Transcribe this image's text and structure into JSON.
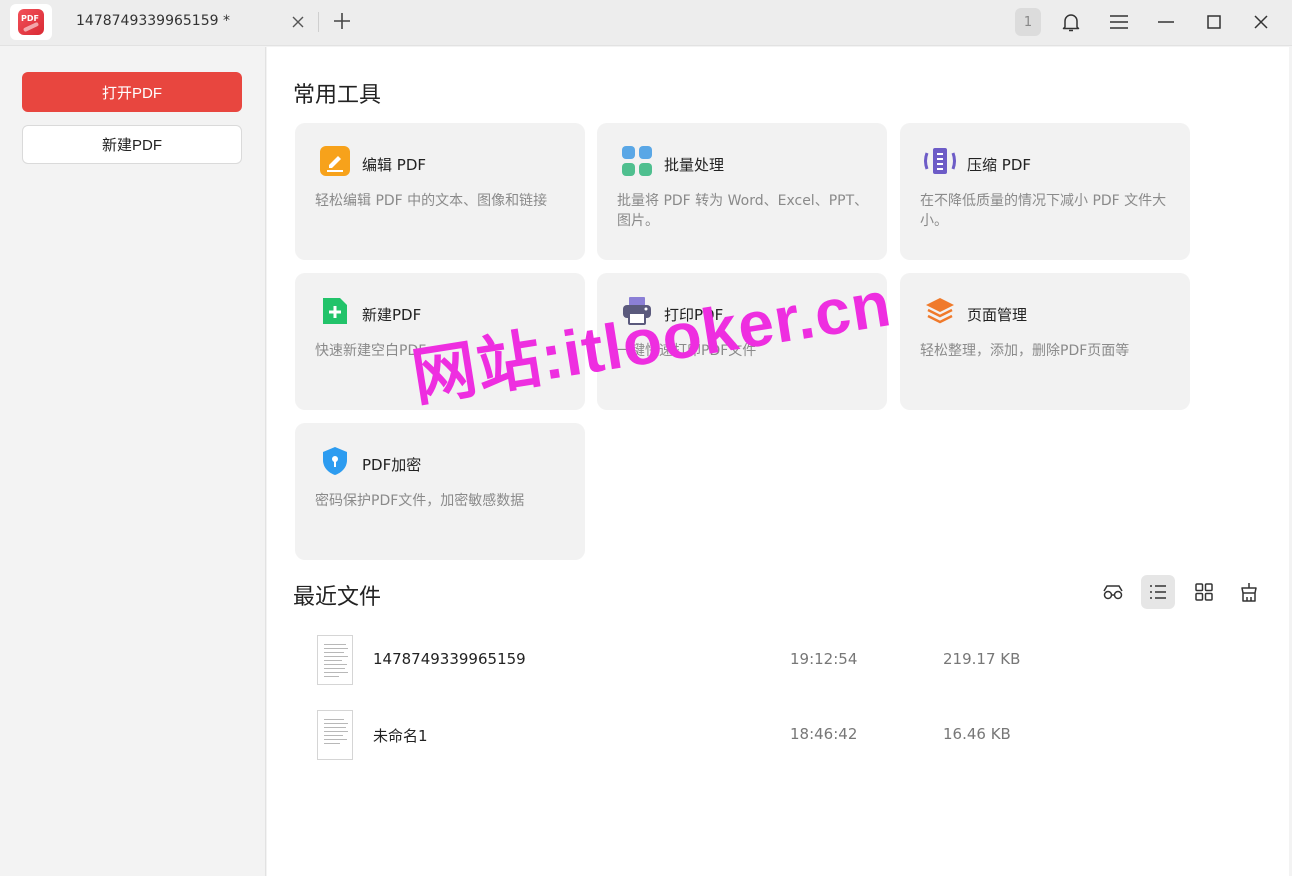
{
  "titlebar": {
    "tab_title": "1478749339965159 *",
    "notification_count": "1",
    "icons": [
      "close-icon",
      "plus-icon",
      "bell-icon",
      "menu-icon",
      "minimize-icon",
      "maximize-icon",
      "close-window-icon"
    ]
  },
  "logo": {
    "text": "PDF"
  },
  "sidebar": {
    "open_label": "打开PDF",
    "new_label": "新建PDF",
    "accent": "#e8463f"
  },
  "tools": {
    "title": "常用工具",
    "items": [
      {
        "icon": "edit-pdf-icon",
        "title": "编辑 PDF",
        "desc": "轻松编辑 PDF 中的文本、图像和链接"
      },
      {
        "icon": "batch-process-icon",
        "title": "批量处理",
        "desc": "批量将 PDF 转为 Word、Excel、PPT、图片。"
      },
      {
        "icon": "compress-pdf-icon",
        "title": "压缩 PDF",
        "desc": "在不降低质量的情况下减小 PDF 文件大小。"
      },
      {
        "icon": "new-pdf-icon",
        "title": "新建PDF",
        "desc": "快速新建空白PDF"
      },
      {
        "icon": "printer-icon",
        "title": "打印PDF",
        "desc": "一键快速打印PDF文件"
      },
      {
        "icon": "layers-icon",
        "title": "页面管理",
        "desc": "轻松整理，添加，删除PDF页面等"
      },
      {
        "icon": "shield-lock-icon",
        "title": "PDF加密",
        "desc": "密码保护PDF文件，加密敏感数据"
      }
    ]
  },
  "recent": {
    "title": "最近文件",
    "view_icons": [
      "glasses-icon",
      "list-view-icon",
      "grid-view-icon",
      "clean-icon"
    ],
    "files": [
      {
        "name": "1478749339965159",
        "time": "19:12:54",
        "size": "219.17 KB"
      },
      {
        "name": "未命名1",
        "time": "18:46:42",
        "size": "16.46 KB"
      }
    ]
  },
  "watermark": "网站:itlooker.cn"
}
